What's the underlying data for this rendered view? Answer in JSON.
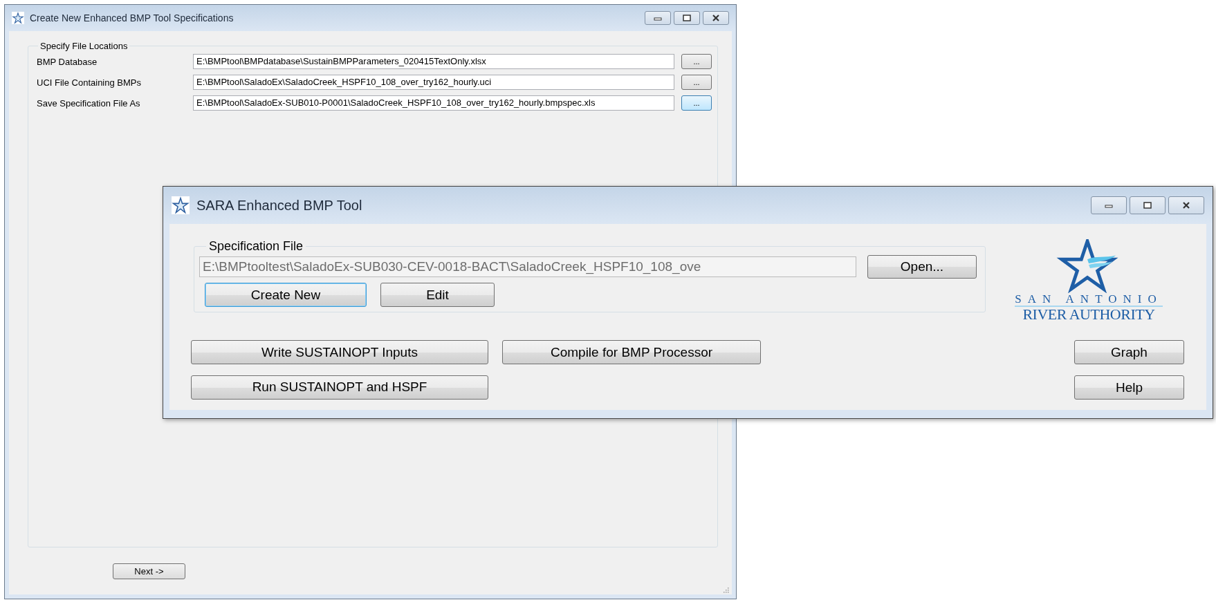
{
  "back_window": {
    "title": "Create New Enhanced BMP Tool Specifications",
    "group_title": "Specify File Locations",
    "rows": [
      {
        "label": "BMP Database",
        "value": "E:\\BMPtool\\BMPdatabase\\SustainBMPParameters_020415TextOnly.xlsx",
        "button": "...",
        "focused": false
      },
      {
        "label": "UCI File Containing BMPs",
        "value": "E:\\BMPtool\\SaladoEx\\SaladoCreek_HSPF10_108_over_try162_hourly.uci",
        "button": "...",
        "focused": false
      },
      {
        "label": "Save Specification File As",
        "value": "E:\\BMPtool\\SaladoEx-SUB010-P0001\\SaladoCreek_HSPF10_108_over_try162_hourly.bmpspec.xls",
        "button": "...",
        "focused": true
      }
    ],
    "next_button": "Next ->"
  },
  "front_window": {
    "title": "SARA Enhanced BMP Tool",
    "group_title": "Specification File",
    "file_path": "E:\\BMPtooltest\\SaladoEx-SUB030-CEV-0018-BACT\\SaladoCreek_HSPF10_108_ove",
    "open_button": "Open...",
    "file_buttons": [
      {
        "label": "Create New",
        "focused": true
      },
      {
        "label": "Edit",
        "focused": false
      }
    ],
    "actions": [
      {
        "label": "Write SUSTAINOPT Inputs"
      },
      {
        "label": "Compile for BMP Processor"
      },
      {
        "label": "Run SUSTAINOPT and HSPF"
      }
    ],
    "side_buttons": [
      {
        "label": "Graph"
      },
      {
        "label": "Help"
      }
    ],
    "logo": {
      "line_1": "SAN ANTONIO",
      "line_2": "RIVER AUTHORITY"
    }
  }
}
